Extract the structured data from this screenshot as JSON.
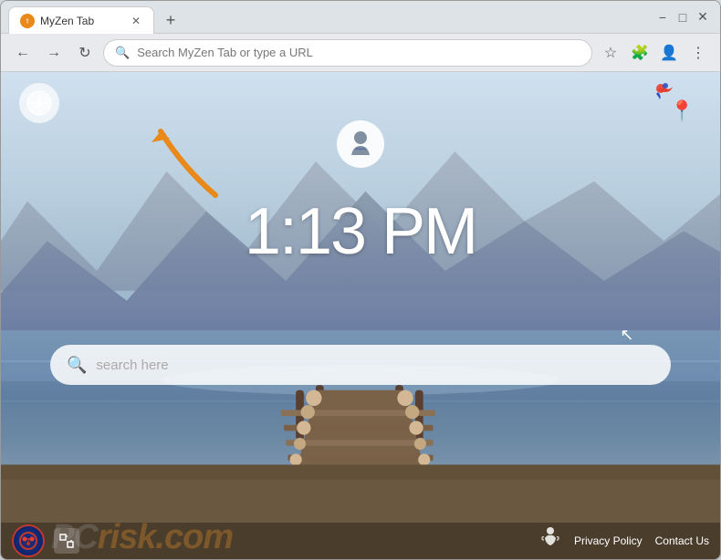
{
  "browser": {
    "tab_title": "MyZen Tab",
    "new_tab_tooltip": "New Tab",
    "url_placeholder": "Search MyZen Tab or type a URL",
    "window_controls": {
      "minimize": "−",
      "maximize": "□",
      "close": "✕"
    }
  },
  "page": {
    "time": "1:13 PM",
    "search_placeholder": "search here",
    "avatar_emoji": "🧘",
    "compass_symbol": "✦",
    "bottom_links": {
      "privacy_policy": "Privacy Policy",
      "contact_us": "Contact Us"
    },
    "pcr_logo_text": "PC",
    "pcr_risk_text": "risk.com",
    "arrow_color": "#e8891a"
  },
  "toolbar": {
    "extensions_tooltip": "Extensions",
    "profile_tooltip": "Profile",
    "menu_tooltip": "Menu",
    "star_tooltip": "Bookmark",
    "back": "←",
    "forward": "→",
    "reload": "↻"
  }
}
